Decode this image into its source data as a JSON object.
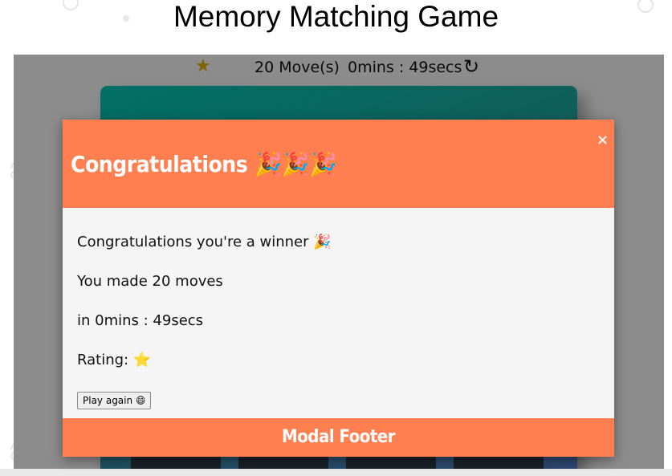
{
  "page": {
    "title": "Memory Matching Game"
  },
  "score_panel": {
    "rating_icon": "star-icon",
    "moves_text": "20 Move(s)",
    "timer_text": "0mins : 49secs",
    "restart_icon": "restart-icon"
  },
  "modal": {
    "title": "Congratulations",
    "title_emoji": "🎉🎉🎉",
    "close_label": "×",
    "message": "Congratulations you're a winner 🎉",
    "moves_line": "You made 20 moves",
    "time_line": "in 0mins : 49secs",
    "rating_label": "Rating:",
    "rating_star": "⭐",
    "play_again_label": "Play again 😄",
    "footer_text": "Modal Footer"
  },
  "colors": {
    "modal_accent": "#ff7f50",
    "modal_body": "#f5f5f5",
    "deck_gradient_start": "#02ccba",
    "deck_gradient_end": "#5a7ed0",
    "star": "#e6b400"
  }
}
